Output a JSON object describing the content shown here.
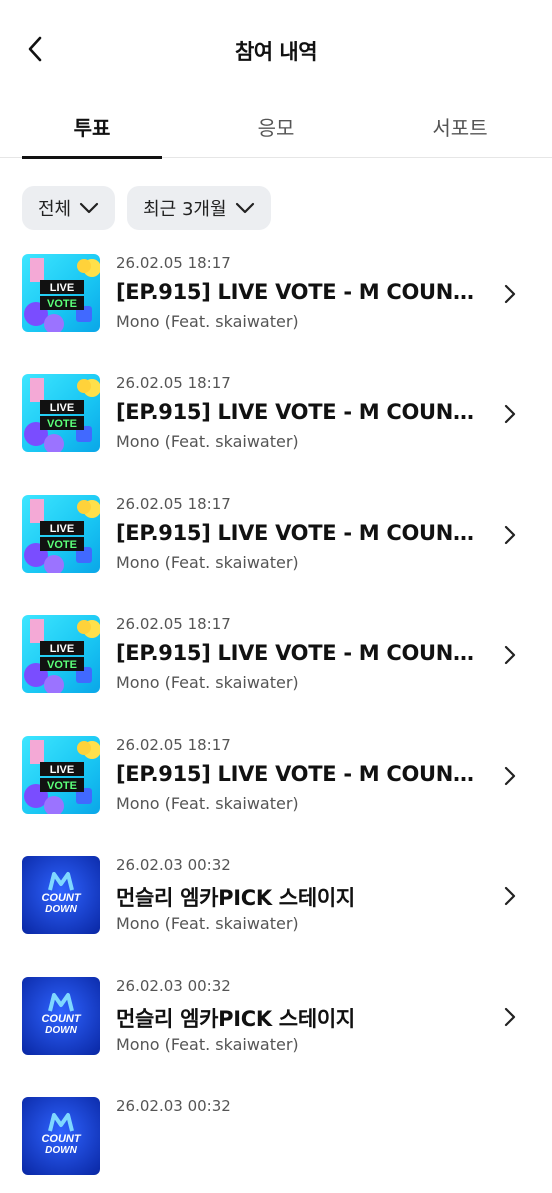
{
  "header": {
    "title": "참여 내역",
    "back_icon": "chevron-left-icon"
  },
  "tabs": [
    {
      "label": "투표",
      "active": true
    },
    {
      "label": "응모",
      "active": false
    },
    {
      "label": "서포트",
      "active": false
    }
  ],
  "filters": [
    {
      "label": "전체",
      "icon": "chevron-down-icon"
    },
    {
      "label": "최근 3개월",
      "icon": "chevron-down-icon"
    }
  ],
  "items": [
    {
      "date": "26.02.05 18:17",
      "title": "[EP.915] LIVE VOTE - M COUNTD...",
      "artist": "Mono (Feat. skaiwater)",
      "thumb": "live-vote"
    },
    {
      "date": "26.02.05 18:17",
      "title": "[EP.915] LIVE VOTE - M COUNTD...",
      "artist": "Mono (Feat. skaiwater)",
      "thumb": "live-vote"
    },
    {
      "date": "26.02.05 18:17",
      "title": "[EP.915] LIVE VOTE - M COUNTD...",
      "artist": "Mono (Feat. skaiwater)",
      "thumb": "live-vote"
    },
    {
      "date": "26.02.05 18:17",
      "title": "[EP.915] LIVE VOTE - M COUNTD...",
      "artist": "Mono (Feat. skaiwater)",
      "thumb": "live-vote"
    },
    {
      "date": "26.02.05 18:17",
      "title": "[EP.915] LIVE VOTE - M COUNTD...",
      "artist": "Mono (Feat. skaiwater)",
      "thumb": "live-vote"
    },
    {
      "date": "26.02.03 00:32",
      "title": "먼슬리 엠카PICK 스테이지",
      "artist": "Mono (Feat. skaiwater)",
      "thumb": "countdown"
    },
    {
      "date": "26.02.03 00:32",
      "title": "먼슬리 엠카PICK 스테이지",
      "artist": "Mono (Feat. skaiwater)",
      "thumb": "countdown"
    },
    {
      "date": "26.02.03 00:32",
      "title": "",
      "artist": "",
      "thumb": "countdown"
    }
  ],
  "thumb_text": {
    "live_vote_line1": "LIVE",
    "live_vote_line2": "VOTE",
    "countdown_line1": "COUNT",
    "countdown_line2": "DOWN"
  },
  "colors": {
    "active_tab": "#111111",
    "chip_bg": "#eceef1",
    "countdown_blue": "#1d47d6"
  }
}
